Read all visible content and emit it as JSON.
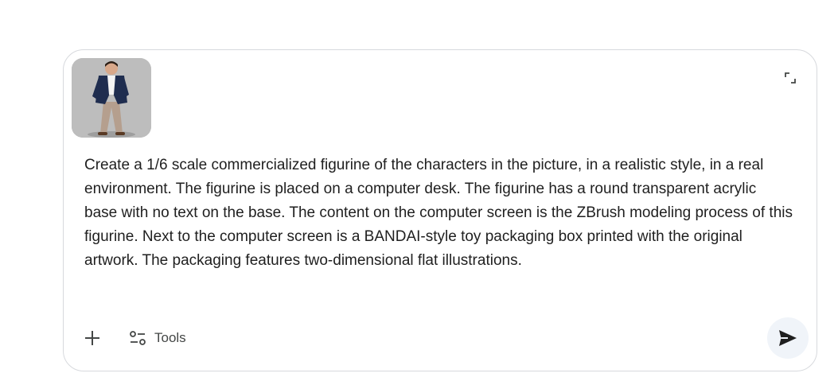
{
  "composer": {
    "prompt_text": "Create a 1/6 scale commercialized figurine of the characters in the picture, in a realistic style, in a real environment. The figurine is placed on a computer desk. The figurine has a round transparent acrylic base with no text on the base. The content on the computer screen is the ZBrush modeling process of this figurine. Next to the computer screen is a BANDAI-style toy packaging box printed with the original artwork. The packaging features two-dimensional flat illustrations.",
    "attachment_alt": "Attached photo of a person in a navy blazer",
    "tools_label": "Tools",
    "icons": {
      "expand": "expand-icon",
      "add": "plus-icon",
      "tools": "tools-sliders-icon",
      "send": "send-icon"
    }
  },
  "colors": {
    "border": "#d7d9dd",
    "text": "#1f1f1f",
    "icon": "#444746",
    "send_bg": "#f0f4f9",
    "send_icon": "#1f1f1f"
  }
}
